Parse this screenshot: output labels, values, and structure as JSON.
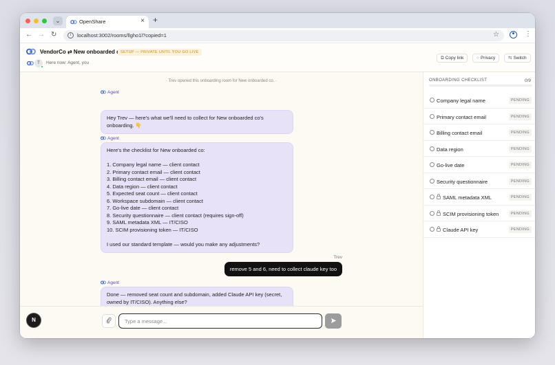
{
  "browser": {
    "tab_title": "OpenShare",
    "search_tabs_icon": "chevron-down-icon",
    "new_tab": "+",
    "tab_close": "×",
    "url": "localhost:3002/rooms/llgho1l?copied=1"
  },
  "header": {
    "brand": "VendorCo ⇄ New onboarded co",
    "status_badge": "SETUP — PRIVATE UNTIL YOU GO LIVE",
    "presence_initial": "T",
    "here_now": "Here now: Agent, you",
    "copy_link": "Copy link",
    "privacy": "Privacy",
    "switch": "Switch"
  },
  "chat": {
    "system_note": "· Trev opened this onboarding room for New onboarded co. ·",
    "agent_name": "Agent",
    "messages": [
      {
        "sender": "Agent",
        "text": "Hey Trev — here's what we'll need to collect for New onboarded co's onboarding. 👇"
      },
      {
        "sender": "Agent",
        "text": "Here's the checklist for New onboarded co:\n\n1. Company legal name — client contact\n2. Primary contact email — client contact\n3. Billing contact email — client contact\n4. Data region — client contact\n5. Expected seat count — client contact\n6. Workspace subdomain — client contact\n7. Go-live date — client contact\n8. Security questionnaire — client contact (requires sign-off)\n9. SAML metadata XML — IT/CISO\n10. SCIM provisioning token — IT/CISO\n\nI used our standard template — would you make any adjustments?"
      },
      {
        "sender": "Trev",
        "text": "remove 5 and 6, need to collect claude key too"
      },
      {
        "sender": "Agent",
        "text": "Done — removed seat count and subdomain, added Claude API key (secret, owned by IT/CISO). Anything else?"
      }
    ]
  },
  "composer": {
    "avatar_initial": "N",
    "placeholder": "Type a message...",
    "attach_icon": "paperclip-icon",
    "send_icon": "send-icon"
  },
  "checklist": {
    "title": "ONBOARDING CHECKLIST",
    "count": "0/9",
    "progress": 0,
    "accent": "#6b59c8",
    "items": [
      {
        "label": "Company legal name",
        "status": "PENDING",
        "locked": false
      },
      {
        "label": "Primary contact email",
        "status": "PENDING",
        "locked": false
      },
      {
        "label": "Billing contact email",
        "status": "PENDING",
        "locked": false
      },
      {
        "label": "Data region",
        "status": "PENDING",
        "locked": false
      },
      {
        "label": "Go-live date",
        "status": "PENDING",
        "locked": false
      },
      {
        "label": "Security questionnaire",
        "status": "PENDING",
        "locked": false
      },
      {
        "label": "SAML metadata XML",
        "status": "PENDING",
        "locked": true
      },
      {
        "label": "SCIM provisioning token",
        "status": "PENDING",
        "locked": true
      },
      {
        "label": "Claude API key",
        "status": "PENDING",
        "locked": true
      }
    ]
  }
}
